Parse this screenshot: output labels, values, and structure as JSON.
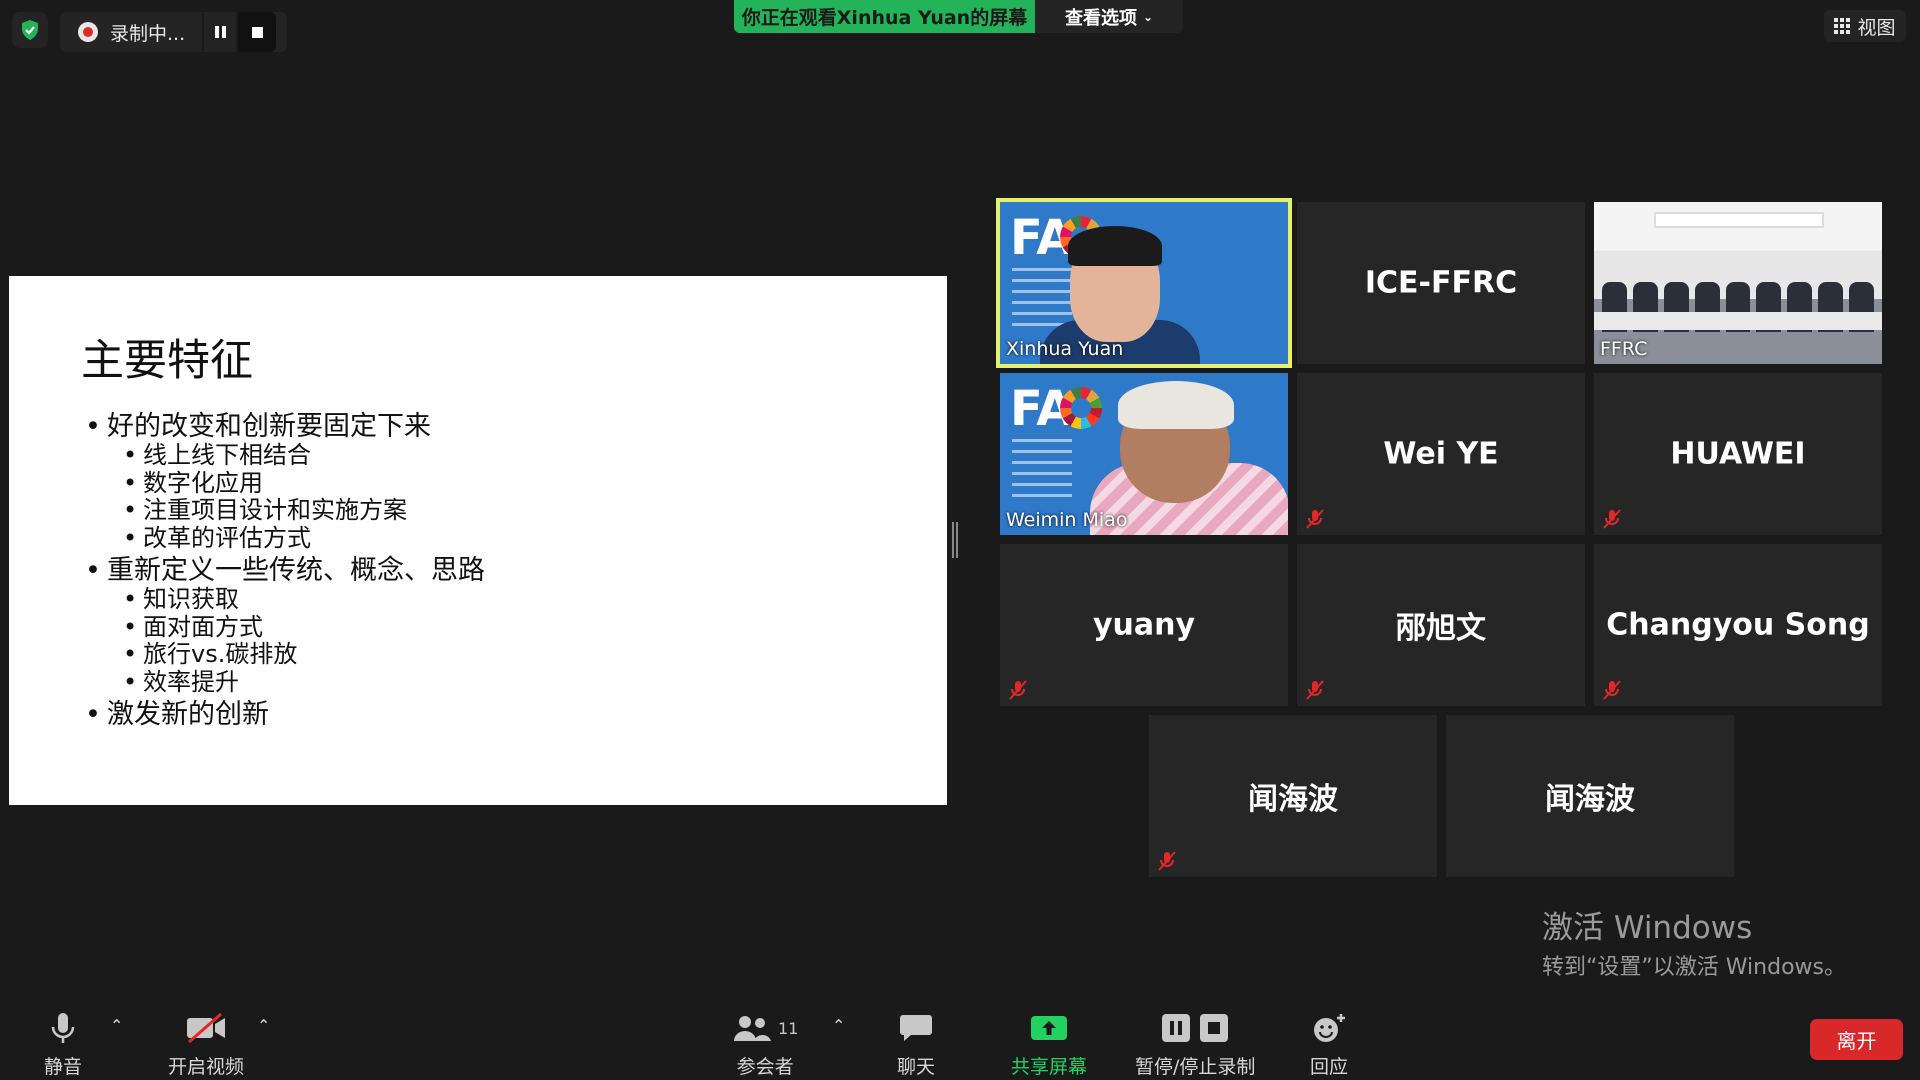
{
  "top": {
    "recording_label": "录制中...",
    "viewing_banner": "你正在观看Xinhua Yuan的屏幕",
    "view_options": "查看选项",
    "view_button": "视图"
  },
  "slide": {
    "title": "主要特征",
    "bullets": [
      {
        "text": "好的改变和创新要固定下来",
        "sub": [
          "线上线下相结合",
          "数字化应用",
          "注重项目设计和实施方案",
          "改革的评估方式"
        ]
      },
      {
        "text": "重新定义一些传统、概念、思路",
        "sub": [
          "知识获取",
          "面对面方式",
          "旅行vs.碳排放",
          "效率提升"
        ]
      },
      {
        "text": "激发新的创新",
        "sub": []
      }
    ]
  },
  "participants": [
    {
      "name": "Xinhua Yuan",
      "muted": false,
      "video": true,
      "active": true
    },
    {
      "name": "ICE-FFRC",
      "muted": false,
      "video": false
    },
    {
      "name": "FFRC",
      "muted": false,
      "video": true
    },
    {
      "name": "Weimin Miao",
      "muted": false,
      "video": true
    },
    {
      "name": "Wei YE",
      "muted": true,
      "video": false
    },
    {
      "name": "HUAWEI",
      "muted": true,
      "video": false
    },
    {
      "name": "yuany",
      "muted": true,
      "video": false
    },
    {
      "name": "邴旭文",
      "muted": true,
      "video": false
    },
    {
      "name": "Changyou Song",
      "muted": true,
      "video": false
    },
    {
      "name": "闻海波",
      "muted": true,
      "video": false
    },
    {
      "name": "闻海波",
      "muted": false,
      "video": false
    }
  ],
  "fao_logo": "FA",
  "activate": {
    "line1": "激活 Windows",
    "line2": "转到“设置”以激活 Windows。"
  },
  "toolbar": {
    "mute": "静音",
    "start_video": "开启视频",
    "participants": "参会者",
    "participants_count": "11",
    "chat": "聊天",
    "share": "共享屏幕",
    "pause_stop_record": "暂停/停止录制",
    "reactions": "回应",
    "leave": "离开"
  },
  "colors": {
    "accent_green": "#23b45a",
    "active_border": "#e7f06a",
    "leave_red": "#d9282a",
    "mute_red": "#e02828"
  }
}
